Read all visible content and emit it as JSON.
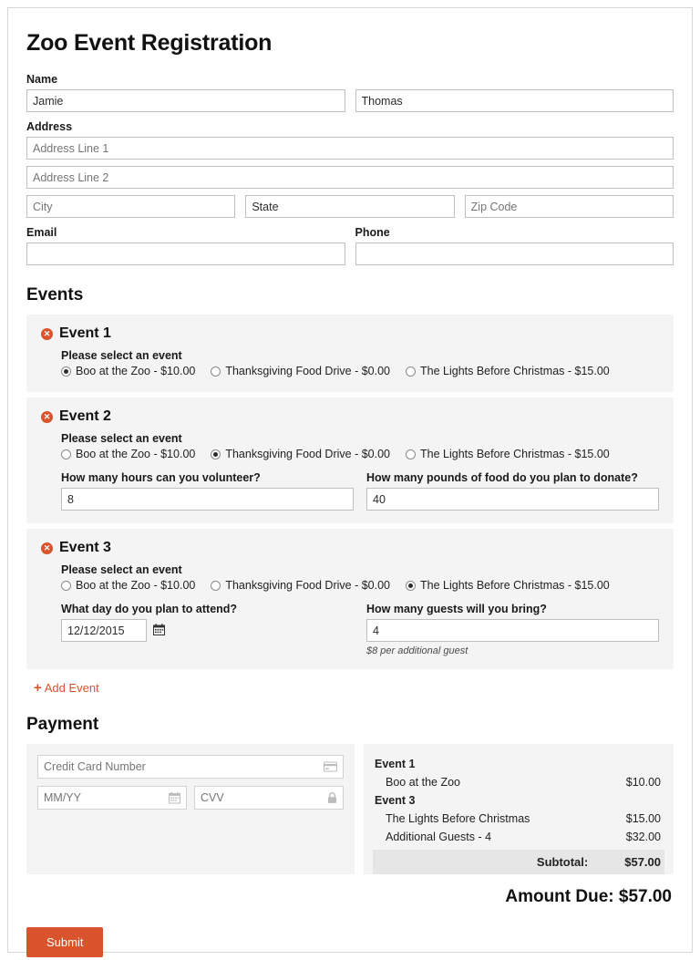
{
  "page": {
    "title": "Zoo Event Registration"
  },
  "colors": {
    "accent": "#d9532c",
    "panel": "#f4f4f4",
    "subtotal_band": "#e6e6e6"
  },
  "name_section": {
    "label": "Name",
    "first_value": "Jamie",
    "last_value": "Thomas"
  },
  "address_section": {
    "label": "Address",
    "line1_placeholder": "Address Line 1",
    "line1_value": "",
    "line2_placeholder": "Address Line 2",
    "line2_value": "",
    "city_placeholder": "City",
    "city_value": "",
    "state_value": "State",
    "zip_placeholder": "Zip Code",
    "zip_value": ""
  },
  "contact_section": {
    "email_label": "Email",
    "email_value": "",
    "phone_label": "Phone",
    "phone_value": ""
  },
  "events_section": {
    "heading": "Events",
    "select_prompt": "Please select an event",
    "options": [
      "Boo at the Zoo - $10.00",
      "Thanksgiving Food Drive - $0.00",
      "The Lights Before Christmas - $15.00"
    ],
    "add_event_label": "Add Event",
    "remove_glyph": "✕",
    "plus_glyph": "+",
    "events": [
      {
        "title": "Event 1",
        "selected_index": 0,
        "questions": []
      },
      {
        "title": "Event 2",
        "selected_index": 1,
        "questions": [
          {
            "label": "How many hours can you volunteer?",
            "value": "8",
            "type": "text",
            "hint": ""
          },
          {
            "label": "How many pounds of food do you plan to donate?",
            "value": "40",
            "type": "text",
            "hint": ""
          }
        ]
      },
      {
        "title": "Event 3",
        "selected_index": 2,
        "questions": [
          {
            "label": "What day do you plan to attend?",
            "value": "12/12/2015",
            "type": "date",
            "hint": ""
          },
          {
            "label": "How many guests will you bring?",
            "value": "4",
            "type": "text",
            "hint": "$8 per additional guest"
          }
        ]
      }
    ]
  },
  "payment_section": {
    "heading": "Payment",
    "card_placeholder": "Credit Card Number",
    "card_value": "",
    "expiry_placeholder": "MM/YY",
    "expiry_value": "",
    "cvv_placeholder": "CVV",
    "cvv_value": "",
    "summary": [
      {
        "kind": "group",
        "label": "Event 1",
        "amount": ""
      },
      {
        "kind": "item",
        "label": "Boo at the Zoo",
        "amount": "$10.00"
      },
      {
        "kind": "group",
        "label": "Event 3",
        "amount": ""
      },
      {
        "kind": "item",
        "label": "The Lights Before Christmas",
        "amount": "$15.00"
      },
      {
        "kind": "item",
        "label": "Additional Guests - 4",
        "amount": "$32.00"
      }
    ],
    "subtotal_label": "Subtotal:",
    "subtotal_amount": "$57.00",
    "amount_due": "Amount Due: $57.00",
    "submit_label": "Submit"
  }
}
